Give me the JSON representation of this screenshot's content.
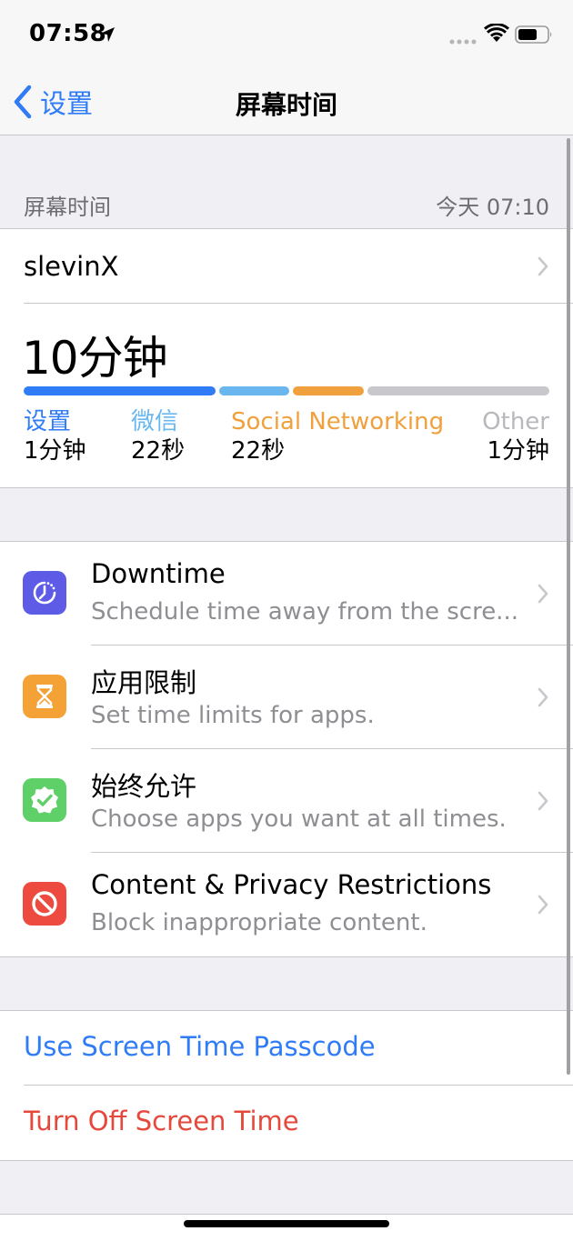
{
  "status_bar": {
    "time": "07:58"
  },
  "nav": {
    "back_label": "设置",
    "title": "屏幕时间"
  },
  "section": {
    "title": "屏幕时间",
    "updated": "今天 07:10"
  },
  "device": {
    "name": "slevinX"
  },
  "usage": {
    "total": "10分钟",
    "categories": [
      {
        "name": "设置",
        "value": "1分钟",
        "color": "#2f7cf6",
        "minutes": 1.0
      },
      {
        "name": "微信",
        "value": "22秒",
        "color": "#6ab7ef",
        "minutes": 0.367
      },
      {
        "name": "Social Networking",
        "value": "22秒",
        "color": "#f0a03c",
        "minutes": 0.367
      },
      {
        "name": "Other",
        "value": "1分钟",
        "color": "#c7c7cc",
        "minutes": 0.95
      }
    ]
  },
  "settings": [
    {
      "title": "Downtime",
      "subtitle": "Schedule time away from the scre...",
      "icon": "downtime-icon",
      "color": "#5e5ce6"
    },
    {
      "title": "应用限制",
      "subtitle": "Set time limits for apps.",
      "icon": "hourglass-icon",
      "color": "#f4a236"
    },
    {
      "title": "始终允许",
      "subtitle": "Choose apps you want at all times.",
      "icon": "checkmark-seal-icon",
      "color": "#5fd068"
    },
    {
      "title": "Content & Privacy Restrictions",
      "subtitle": "Block inappropriate content.",
      "icon": "restriction-icon",
      "color": "#ed4b40"
    }
  ],
  "actions": {
    "passcode": "Use Screen Time Passcode",
    "turn_off": "Turn Off Screen Time",
    "passcode_color": "#2f7cf6",
    "turn_off_color": "#e5493c"
  }
}
